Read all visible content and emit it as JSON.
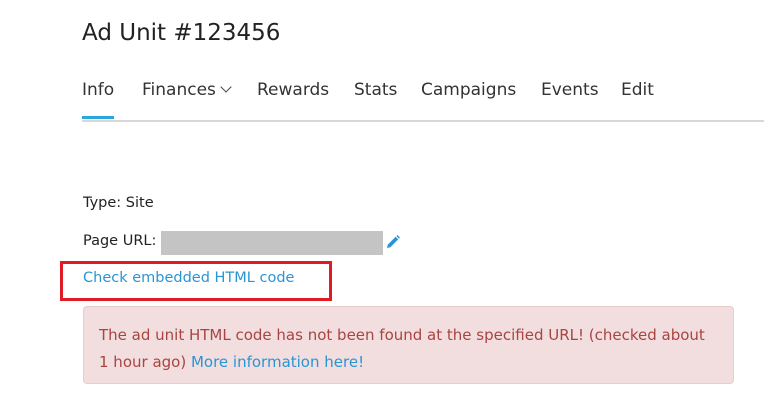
{
  "page": {
    "title": "Ad Unit #123456"
  },
  "tabs": [
    {
      "label": "Info",
      "active": true
    },
    {
      "label": "Finances",
      "has_dropdown": true
    },
    {
      "label": "Rewards"
    },
    {
      "label": "Stats"
    },
    {
      "label": "Campaigns"
    },
    {
      "label": "Events"
    },
    {
      "label": "Edit"
    }
  ],
  "details": {
    "type_label": "Type: Site",
    "page_url_label": "Page URL:",
    "edit_icon": "pencil-icon",
    "check_link": "Check embedded HTML code"
  },
  "alert": {
    "message": "The ad unit HTML code has not been found at the specified URL! (checked about 1 hour ago)",
    "link_text": "More information here!"
  },
  "colors": {
    "accent": "#2aa7dd",
    "link": "#2a95d4",
    "highlight": "#e01b24",
    "alert_bg": "#f2dede",
    "alert_text": "#a94442"
  }
}
